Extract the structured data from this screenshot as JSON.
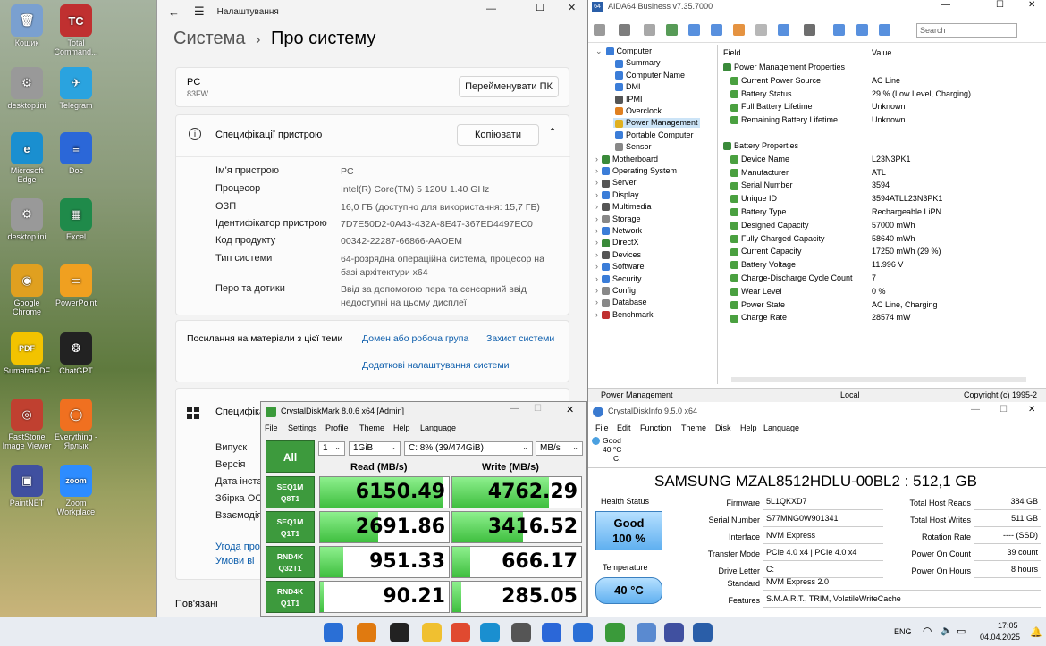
{
  "desktop": {
    "icons": [
      {
        "label": "Кошик",
        "color": "#7aa0d0",
        "glyph": "🗑"
      },
      {
        "label": "Total Command...",
        "color": "#c03030",
        "glyph": "TC"
      },
      {
        "label": "desktop.ini",
        "color": "#999",
        "glyph": "⚙"
      },
      {
        "label": "Telegram",
        "color": "#2aa3df",
        "glyph": "✈"
      },
      {
        "label": "Microsoft Edge",
        "color": "#1a8fd0",
        "glyph": "e"
      },
      {
        "label": "Doc",
        "color": "#2b67d8",
        "glyph": "≡"
      },
      {
        "label": "desktop.ini",
        "color": "#999",
        "glyph": "⚙"
      },
      {
        "label": "Excel",
        "color": "#1f8a4a",
        "glyph": "▦"
      },
      {
        "label": "Google Chrome",
        "color": "#e0a020",
        "glyph": "◉"
      },
      {
        "label": "PowerPoint",
        "color": "#f0a020",
        "glyph": "▭"
      },
      {
        "label": "SumatraPDF",
        "color": "#f2c300",
        "glyph": "PDF"
      },
      {
        "label": "ChatGPT",
        "color": "#222",
        "glyph": "❂"
      },
      {
        "label": "FastStone Image Viewer",
        "color": "#c04030",
        "glyph": "◎"
      },
      {
        "label": "Everything - Ярлык",
        "color": "#f07020",
        "glyph": "◯"
      },
      {
        "label": "PaintNET",
        "color": "#4050a0",
        "glyph": "▣"
      },
      {
        "label": "Zoom Workplace",
        "color": "#2d8cff",
        "glyph": "zoom"
      }
    ]
  },
  "settings": {
    "app_title": "Налаштування",
    "breadcrumb_parent": "Система",
    "breadcrumb_sep": "›",
    "breadcrumb_current": "Про систему",
    "pc_name": "PC",
    "pc_model": "83FW",
    "rename_btn": "Перейменувати ПК",
    "spec_title": "Специфікації пристрою",
    "copy_btn": "Копіювати",
    "specs": [
      {
        "label": "Ім'я пристрою",
        "value": "PC"
      },
      {
        "label": "Процесор",
        "value": "Intel(R) Core(TM) 5 120U   1.40 GHz"
      },
      {
        "label": "ОЗП",
        "value": "16,0 ГБ (доступно для використання: 15,7 ГБ)"
      },
      {
        "label": "Ідентифікатор пристрою",
        "value": "7D7E50D2-0A43-432A-8E47-367ED4497EC0"
      },
      {
        "label": "Код продукту",
        "value": "00342-22287-66866-AAOEM"
      },
      {
        "label": "Тип системи",
        "value": "64-розрядна операційна система, процесор на базі архітектури x64"
      },
      {
        "label": "Перо та дотики",
        "value": "Ввід за допомогою пера та сенсорний ввід недоступні на цьому дисплеї"
      }
    ],
    "links_label": "Посилання на матеріали з цієї теми",
    "link1": "Домен або робоча група",
    "link2": "Захист системи",
    "link3": "Додаткові налаштування системи",
    "win_spec_title": "Специфіка",
    "win_specs": [
      "Випуск",
      "Версія",
      "Дата інста",
      "Збірка ОС",
      "Взаємодія"
    ],
    "win_links": [
      "Угода про",
      "Умови ві"
    ],
    "related": "Пов'язані"
  },
  "aida": {
    "title": "AIDA64 Business v7.35.7000",
    "search_placeholder": "Search",
    "tree": [
      {
        "t": "Computer",
        "lvl": 1,
        "c": "#3b7dd8"
      },
      {
        "t": "Summary",
        "lvl": 2,
        "c": "#3b7dd8"
      },
      {
        "t": "Computer Name",
        "lvl": 2,
        "c": "#3b7dd8"
      },
      {
        "t": "DMI",
        "lvl": 2,
        "c": "#3b7dd8"
      },
      {
        "t": "IPMI",
        "lvl": 2,
        "c": "#555"
      },
      {
        "t": "Overclock",
        "lvl": 2,
        "c": "#e08020"
      },
      {
        "t": "Power Management",
        "lvl": 2,
        "c": "#e0b020",
        "sel": true
      },
      {
        "t": "Portable Computer",
        "lvl": 2,
        "c": "#3b7dd8"
      },
      {
        "t": "Sensor",
        "lvl": 2,
        "c": "#888"
      },
      {
        "t": "Motherboard",
        "lvl": 0,
        "c": "#3a8a3a"
      },
      {
        "t": "Operating System",
        "lvl": 0,
        "c": "#3b7dd8"
      },
      {
        "t": "Server",
        "lvl": 0,
        "c": "#555"
      },
      {
        "t": "Display",
        "lvl": 0,
        "c": "#3b7dd8"
      },
      {
        "t": "Multimedia",
        "lvl": 0,
        "c": "#555"
      },
      {
        "t": "Storage",
        "lvl": 0,
        "c": "#888"
      },
      {
        "t": "Network",
        "lvl": 0,
        "c": "#3b7dd8"
      },
      {
        "t": "DirectX",
        "lvl": 0,
        "c": "#3a8a3a"
      },
      {
        "t": "Devices",
        "lvl": 0,
        "c": "#555"
      },
      {
        "t": "Software",
        "lvl": 0,
        "c": "#3b7dd8"
      },
      {
        "t": "Security",
        "lvl": 0,
        "c": "#3b7dd8"
      },
      {
        "t": "Config",
        "lvl": 0,
        "c": "#888"
      },
      {
        "t": "Database",
        "lvl": 0,
        "c": "#888"
      },
      {
        "t": "Benchmark",
        "lvl": 0,
        "c": "#c03030"
      }
    ],
    "col_field": "Field",
    "col_value": "Value",
    "groups": [
      {
        "title": "Power Management Properties",
        "rows": [
          [
            "Current Power Source",
            "AC Line"
          ],
          [
            "Battery Status",
            "29 % (Low Level, Charging)"
          ],
          [
            "Full Battery Lifetime",
            "Unknown"
          ],
          [
            "Remaining Battery Lifetime",
            "Unknown"
          ]
        ]
      },
      {
        "title": "Battery Properties",
        "rows": [
          [
            "Device Name",
            "L23N3PK1"
          ],
          [
            "Manufacturer",
            "ATL"
          ],
          [
            "Serial Number",
            "3594"
          ],
          [
            "Unique ID",
            "3594ATLL23N3PK1"
          ],
          [
            "Battery Type",
            "Rechargeable LiPN"
          ],
          [
            "Designed Capacity",
            "57000 mWh"
          ],
          [
            "Fully Charged Capacity",
            "58640 mWh"
          ],
          [
            "Current Capacity",
            "17250 mWh  (29 %)"
          ],
          [
            "Battery Voltage",
            "11.996 V"
          ],
          [
            "Charge-Discharge Cycle Count",
            "7"
          ],
          [
            "Wear Level",
            "0 %"
          ],
          [
            "Power State",
            "AC Line, Charging"
          ],
          [
            "Charge Rate",
            "28574 mW"
          ]
        ]
      }
    ],
    "status_left": "Power Management",
    "status_mid": "Local",
    "status_right": "Copyright (c) 1995-2"
  },
  "cdm": {
    "title": "CrystalDiskMark 8.0.6 x64 [Admin]",
    "menu": [
      "File",
      "Settings",
      "Profile",
      "Theme",
      "Help",
      "Language"
    ],
    "all_btn": "All",
    "count": "1",
    "size": "1GiB",
    "drive": "C: 8% (39/474GiB)",
    "unit": "MB/s",
    "read_hdr": "Read (MB/s)",
    "write_hdr": "Write (MB/s)",
    "rows": [
      {
        "l1": "SEQ1M",
        "l2": "Q8T1",
        "read": "6150.49",
        "write": "4762.29",
        "rf": 0.95,
        "wf": 0.75
      },
      {
        "l1": "SEQ1M",
        "l2": "Q1T1",
        "read": "2691.86",
        "write": "3416.52",
        "rf": 0.45,
        "wf": 0.55
      },
      {
        "l1": "RND4K",
        "l2": "Q32T1",
        "read": "951.33",
        "write": "666.17",
        "rf": 0.18,
        "wf": 0.14
      },
      {
        "l1": "RND4K",
        "l2": "Q1T1",
        "read": "90.21",
        "write": "285.05",
        "rf": 0.03,
        "wf": 0.07
      }
    ]
  },
  "cdi": {
    "title": "CrystalDiskInfo 9.5.0 x64",
    "menu": [
      "File",
      "Edit",
      "Function",
      "Theme",
      "Disk",
      "Help",
      "Language"
    ],
    "disk_status": "Good",
    "disk_temp": "40 °C",
    "disk_letter": "C:",
    "model": "SAMSUNG MZAL8512HDLU-00BL2 : 512,1 GB",
    "health_label": "Health Status",
    "health_word": "Good",
    "health_pct": "100 %",
    "temp_label": "Temperature",
    "temp_value": "40 °C",
    "fields": [
      [
        "Firmware",
        "5L1QKXD7"
      ],
      [
        "Serial Number",
        "S77MNG0W901341"
      ],
      [
        "Interface",
        "NVM Express"
      ],
      [
        "Transfer Mode",
        "PCIe 4.0 x4 | PCIe 4.0 x4"
      ],
      [
        "Drive Letter",
        "C:"
      ]
    ],
    "standard_label": "Standard",
    "standard": "NVM Express 2.0",
    "features_label": "Features",
    "features": "S.M.A.R.T., TRIM, VolatileWriteCache",
    "right": [
      [
        "Total Host Reads",
        "384 GB"
      ],
      [
        "Total Host Writes",
        "511 GB"
      ],
      [
        "Rotation Rate",
        "---- (SSD)"
      ],
      [
        "Power On Count",
        "39 count"
      ],
      [
        "Power On Hours",
        "8 hours"
      ]
    ]
  },
  "taskbar": {
    "lang": "ENG",
    "time": "17:05",
    "date": "04.04.2025"
  }
}
